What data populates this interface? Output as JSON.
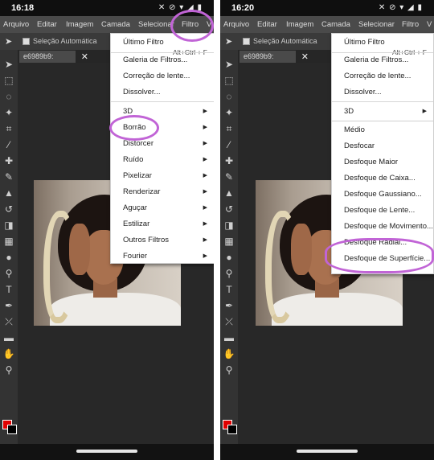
{
  "colors": {
    "accent": "#c164d6",
    "foreground": "#e00000",
    "background": "#000000"
  },
  "screen1": {
    "time": "16:18",
    "menubar": [
      "Arquivo",
      "Editar",
      "Imagem",
      "Camada",
      "Selecionar",
      "Filtro",
      "V"
    ],
    "options": {
      "autoselect": "Seleção Automática"
    },
    "tab": {
      "title": "e6989b9:",
      "close": "✕"
    },
    "menu": {
      "ultimo": "Último Filtro",
      "shortcut": "Alt+Ctrl + F",
      "galeria": "Galeria de Filtros...",
      "correcao": "Correção de lente...",
      "dissolver": "Dissolver...",
      "submenus": [
        "3D",
        "Borrão",
        "Distorcer",
        "Ruído",
        "Pixelizar",
        "Renderizar",
        "Aguçar",
        "Estilizar",
        "Outros Filtros",
        "Fourier"
      ]
    }
  },
  "screen2": {
    "time": "16:20",
    "menubar": [
      "Arquivo",
      "Editar",
      "Imagem",
      "Camada",
      "Selecionar",
      "Filtro",
      "V"
    ],
    "options": {
      "autoselect": "Seleção Automática"
    },
    "tab": {
      "title": "e6989b9:",
      "close": "✕"
    },
    "menu": {
      "ultimo": "Último Filtro",
      "shortcut": "Alt+Ctrl + F",
      "galeria": "Galeria de Filtros...",
      "correcao": "Correção de lente...",
      "dissolver": "Dissolver...",
      "d3": "3D",
      "blur_items": [
        "Médio",
        "Desfocar",
        "Desfoque Maior",
        "Desfoque de Caixa...",
        "Desfoque Gaussiano...",
        "Desfoque de Lente...",
        "Desfoque de Movimento...",
        "Desfoque Radial...",
        "Desfoque de Superfície..."
      ]
    }
  }
}
